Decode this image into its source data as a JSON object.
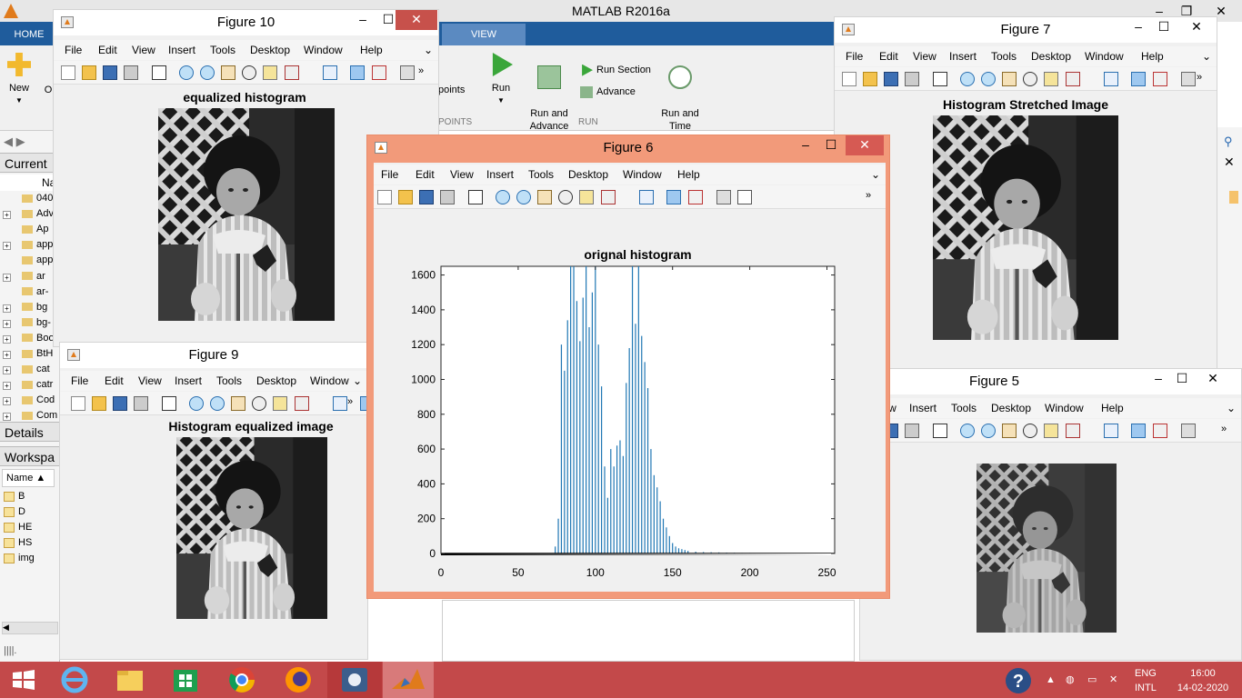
{
  "matlab": {
    "title": "MATLAB R2016a",
    "tabs": [
      "HOME",
      "VIEW"
    ],
    "ribbon": {
      "new_label": "New",
      "open_label": "O",
      "breakpoints_label": "points",
      "run_label": "Run",
      "run_advance_label": "Run and\nAdvance",
      "run_section_label": "Run Section",
      "advance_label": "Advance",
      "run_time_label": "Run and\nTime",
      "section_run": "RUN",
      "section_points": "POINTS"
    },
    "left_panel": {
      "current_folder_label": "Current",
      "name_col": "Na",
      "files": [
        "040",
        "Adv",
        "Ap",
        "app",
        "app",
        "ar",
        "ar-",
        "bg",
        "bg-",
        "Boo",
        "BtH",
        "cat",
        "catr",
        "Cod",
        "Com"
      ],
      "details_label": "Details",
      "workspace_label": "Workspa",
      "ws_name_col": "Name",
      "ws_vars": [
        "B",
        "D",
        "HE",
        "HS",
        "img"
      ]
    }
  },
  "menus": [
    "File",
    "Edit",
    "View",
    "Insert",
    "Tools",
    "Desktop",
    "Window",
    "Help"
  ],
  "figures": {
    "fig10": {
      "title": "Figure 10",
      "plot_title": "equalized histogram"
    },
    "fig9": {
      "title": "Figure 9",
      "plot_title": "Histogram equalized image"
    },
    "fig7": {
      "title": "Figure 7",
      "plot_title": "Histogram Stretched Image"
    },
    "fig5": {
      "title": "Figure 5"
    },
    "fig6": {
      "title": "Figure 6"
    }
  },
  "chart_data": {
    "type": "bar",
    "title": "orignal histogram",
    "xlabel": "",
    "ylabel": "",
    "xlim": [
      0,
      255
    ],
    "ylim": [
      0,
      1650
    ],
    "xticks": [
      0,
      50,
      100,
      150,
      200,
      250
    ],
    "yticks": [
      0,
      200,
      400,
      600,
      800,
      1000,
      1200,
      1400,
      1600
    ],
    "bar_color": "#1f77b4",
    "colorbar": "grayscale 0-255 below axis",
    "x": [
      74,
      76,
      78,
      80,
      82,
      84,
      86,
      88,
      90,
      92,
      94,
      96,
      98,
      100,
      102,
      104,
      106,
      108,
      110,
      112,
      114,
      116,
      118,
      120,
      122,
      124,
      126,
      128,
      130,
      132,
      134,
      136,
      138,
      140,
      142,
      144,
      146,
      148,
      150,
      152,
      154,
      156,
      158,
      160,
      165,
      170,
      175,
      180,
      185,
      190,
      195,
      200,
      205,
      210,
      215,
      220
    ],
    "values": [
      40,
      200,
      1200,
      1050,
      1340,
      1650,
      1650,
      1450,
      1220,
      1470,
      1650,
      1300,
      1500,
      1650,
      1200,
      960,
      500,
      320,
      600,
      500,
      620,
      650,
      560,
      980,
      1180,
      1650,
      1320,
      1650,
      1250,
      1100,
      950,
      600,
      450,
      380,
      300,
      200,
      150,
      100,
      60,
      40,
      30,
      25,
      20,
      15,
      10,
      8,
      7,
      6,
      5,
      4,
      3,
      3,
      2,
      2,
      1,
      1
    ]
  },
  "taskbar": {
    "lang_top": "ENG",
    "lang_bottom": "INTL",
    "time": "16:00",
    "date": "14-02-2020"
  }
}
